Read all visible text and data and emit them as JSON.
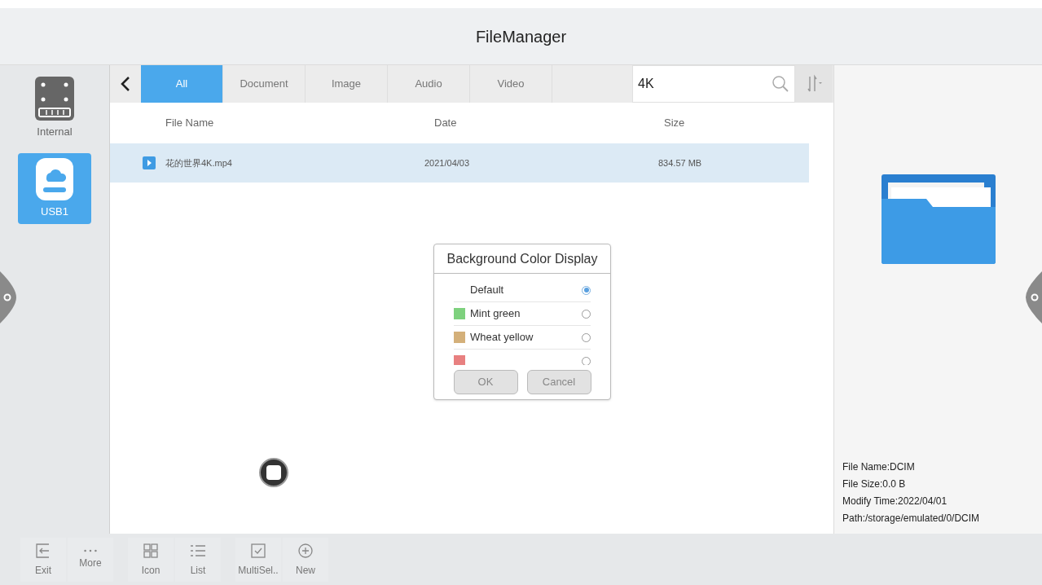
{
  "window": {
    "title": "FileManager"
  },
  "devices": [
    {
      "label": "Internal",
      "kind": "internal",
      "selected": false
    },
    {
      "label": "USB1",
      "kind": "usb",
      "selected": true
    }
  ],
  "tabs": [
    {
      "label": "All",
      "selected": true
    },
    {
      "label": "Document",
      "selected": false
    },
    {
      "label": "Image",
      "selected": false
    },
    {
      "label": "Audio",
      "selected": false
    },
    {
      "label": "Video",
      "selected": false
    }
  ],
  "search": {
    "value": "4K"
  },
  "table": {
    "columns": [
      "File Name",
      "Date",
      "Size"
    ],
    "rows": [
      {
        "name": "花的世界4K.mp4",
        "date": "2021/04/03",
        "size": "834.57 MB",
        "selected": true
      }
    ]
  },
  "dialog": {
    "title": "Background Color Display",
    "options": [
      {
        "label": "Default",
        "selected": true
      },
      {
        "label": "Mint green",
        "color": "#7ed17e",
        "selected": false
      },
      {
        "label": "Wheat yellow",
        "color": "#d4b07a",
        "selected": false
      },
      {
        "color": "#e88080",
        "selected": false
      }
    ],
    "buttons": [
      "OK",
      "Cancel"
    ]
  },
  "details": [
    "File Name:DCIM",
    "File Size:0.0 B",
    "Modify Time:2022/04/01",
    "Path:/storage/emulated/0/DCIM"
  ],
  "toolbar": [
    [
      {
        "label": "Exit",
        "kind": "exit"
      },
      {
        "label": "More",
        "kind": "more"
      }
    ],
    [
      {
        "label": "Icon",
        "kind": "grid"
      },
      {
        "label": "List",
        "kind": "list"
      }
    ],
    [
      {
        "label": "MultiSel..",
        "kind": "check"
      },
      {
        "label": "New",
        "kind": "new"
      }
    ]
  ]
}
